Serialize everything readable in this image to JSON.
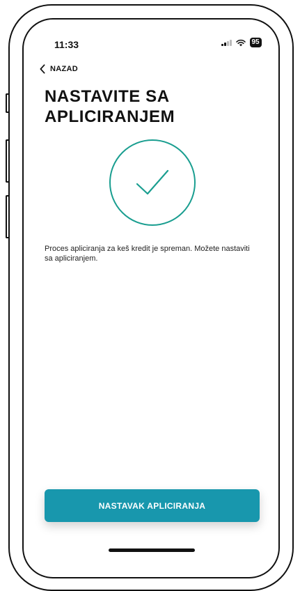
{
  "status_bar": {
    "time": "11:33",
    "battery": "95",
    "signal_icon": "signal-icon",
    "wifi_icon": "wifi-icon"
  },
  "nav": {
    "back_label": "NAZAD",
    "back_icon": "chevron-left-icon"
  },
  "page": {
    "title": "NASTAVITE SA APLICIRANJEM",
    "success_icon": "check-circle-icon",
    "message": "Proces apliciranja za keš kredit je spreman. Možete nastaviti sa apliciranjem."
  },
  "actions": {
    "continue_label": "NASTAVAK APLICIRANJA"
  },
  "colors": {
    "accent": "#1897ad",
    "check": "#1a9e90",
    "text": "#111111"
  }
}
